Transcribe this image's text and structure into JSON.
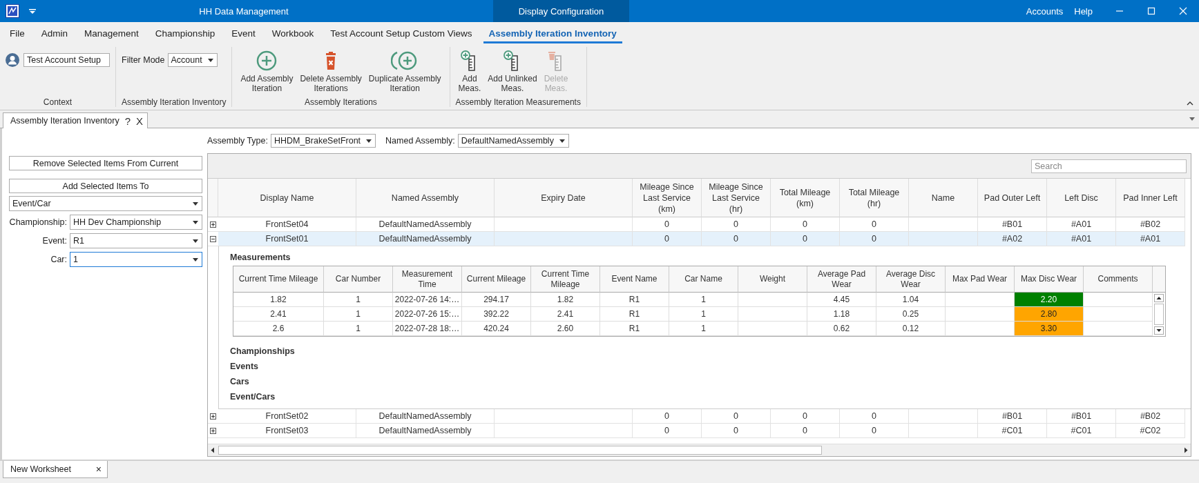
{
  "window": {
    "title": "HH Data Management",
    "context_title": "Display Configuration",
    "links": [
      "Accounts",
      "Help"
    ]
  },
  "menu": [
    {
      "label": "File",
      "selected": false
    },
    {
      "label": "Admin",
      "selected": false
    },
    {
      "label": "Management",
      "selected": false
    },
    {
      "label": "Championship",
      "selected": false
    },
    {
      "label": "Event",
      "selected": false
    },
    {
      "label": "Workbook",
      "selected": false
    },
    {
      "label": "Test Account Setup Custom Views",
      "selected": false
    },
    {
      "label": "Assembly Iteration Inventory",
      "selected": true
    }
  ],
  "ribbon": [
    {
      "label": "Context",
      "items": [
        {
          "kind": "account",
          "value": "Test Account Setup"
        }
      ]
    },
    {
      "label": "Assembly Iteration Inventory",
      "items": [
        {
          "kind": "filter",
          "label": "Filter Mode",
          "value": "Account"
        }
      ]
    },
    {
      "label": "Assembly Iterations",
      "items": [
        {
          "kind": "add",
          "label": "Add Assembly\nIteration",
          "disabled": false
        },
        {
          "kind": "delete",
          "label": "Delete Assembly\nIterations",
          "disabled": false
        },
        {
          "kind": "duplicate",
          "label": "Duplicate Assembly\nIteration",
          "disabled": false
        }
      ]
    },
    {
      "label": "Assembly Iteration Measurements",
      "items": [
        {
          "kind": "add-measure",
          "label": "Add\nMeas.",
          "disabled": false
        },
        {
          "kind": "add-unlinked",
          "label": "Add Unlinked\nMeas.",
          "disabled": false
        },
        {
          "kind": "delete-measure",
          "label": "Delete\nMeas.",
          "disabled": true
        }
      ]
    }
  ],
  "doc_tab": {
    "title": "Assembly Iteration Inventory",
    "help": "?",
    "close": "X"
  },
  "left_panel": {
    "buttons": [
      "Remove Selected Items From Current",
      "Add Selected Items To"
    ],
    "target": "Event/Car",
    "fields": [
      {
        "label": "Championship:",
        "value": "HH Dev Championship",
        "focused": false
      },
      {
        "label": "Event:",
        "value": "R1",
        "focused": false
      },
      {
        "label": "Car:",
        "value": "1",
        "focused": true
      }
    ]
  },
  "filters": [
    {
      "label": "Assembly Type:",
      "value": "HHDM_BrakeSetFront"
    },
    {
      "label": "Named Assembly:",
      "value": "DefaultNamedAssembly"
    }
  ],
  "grid": {
    "search_placeholder": "Search",
    "columns": [
      "Display Name",
      "Named Assembly",
      "Expiry Date",
      "Mileage Since Last Service (km)",
      "Mileage Since Last Service (hr)",
      "Total Mileage (km)",
      "Total Mileage (hr)",
      "Name",
      "Pad Outer Left",
      "Left Disc",
      "Pad Inner Left"
    ],
    "rows": [
      {
        "expanded": false,
        "selected": false,
        "cells": [
          "FrontSet04",
          "DefaultNamedAssembly",
          null,
          "0",
          "0",
          "0",
          "0",
          null,
          "#B01",
          "#A01",
          "#B02"
        ]
      },
      {
        "expanded": true,
        "selected": true,
        "cells": [
          "FrontSet01",
          "DefaultNamedAssembly",
          null,
          "0",
          "0",
          "0",
          "0",
          null,
          "#A02",
          "#A01",
          "#A01"
        ],
        "detail": {
          "sections": [
            {
              "title": "Measurements",
              "table": {
                "columns": [
                  "Current Time Mileage",
                  "Car Number",
                  "Measurement Time",
                  "Current Mileage",
                  "Current Time Mileage",
                  "Event Name",
                  "Car Name",
                  "Weight",
                  "Average Pad Wear",
                  "Average Disc Wear",
                  "Max Pad Wear",
                  "Max Disc Wear",
                  "Comments"
                ],
                "rows": [
                  {
                    "cells": [
                      "1.82",
                      "1",
                      "2022-07-26 14:…",
                      "294.17",
                      "1.82",
                      "R1",
                      "1",
                      null,
                      "4.45",
                      "1.04",
                      null,
                      {
                        "text": "2.20",
                        "color": "#008000"
                      },
                      null
                    ]
                  },
                  {
                    "cells": [
                      "2.41",
                      "1",
                      "2022-07-26 15:…",
                      "392.22",
                      "2.41",
                      "R1",
                      "1",
                      null,
                      "1.18",
                      "0.25",
                      null,
                      {
                        "text": "2.80",
                        "color": "#ffa500"
                      },
                      null
                    ]
                  },
                  {
                    "cells": [
                      "2.6",
                      "1",
                      "2022-07-28 18:…",
                      "420.24",
                      "2.60",
                      "R1",
                      "1",
                      null,
                      "0.62",
                      "0.12",
                      null,
                      {
                        "text": "3.30",
                        "color": "#ffa500"
                      },
                      null
                    ]
                  }
                ]
              }
            },
            {
              "title": "Championships"
            },
            {
              "title": "Events"
            },
            {
              "title": "Cars"
            },
            {
              "title": "Event/Cars"
            }
          ]
        }
      },
      {
        "expanded": false,
        "selected": false,
        "cells": [
          "FrontSet02",
          "DefaultNamedAssembly",
          null,
          "0",
          "0",
          "0",
          "0",
          null,
          "#B01",
          "#B01",
          "#B02"
        ]
      },
      {
        "expanded": false,
        "selected": false,
        "cells": [
          "FrontSet03",
          "DefaultNamedAssembly",
          null,
          "0",
          "0",
          "0",
          "0",
          null,
          "#C01",
          "#C01",
          "#C02"
        ]
      }
    ]
  },
  "bottom": {
    "worksheet_tab": {
      "label": "New Worksheet",
      "close": "×"
    }
  }
}
